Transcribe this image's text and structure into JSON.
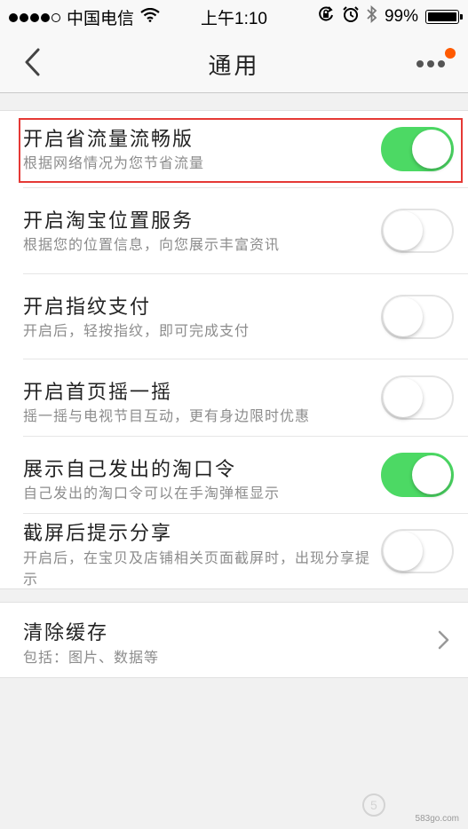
{
  "status_bar": {
    "carrier": "中国电信",
    "time": "上午1:10",
    "battery": "99%",
    "battery_level": 0.99,
    "icons": [
      "signal-dots-icon",
      "wifi-icon",
      "rotation-lock-icon",
      "alarm-icon",
      "bluetooth-icon",
      "battery-icon"
    ]
  },
  "nav": {
    "title": "通用",
    "back_icon": "chevron-left-icon",
    "more_icon": "more-dots-icon",
    "notify_color": "#ff5a00"
  },
  "settings": [
    {
      "title": "开启省流量流畅版",
      "desc": "根据网络情况为您节省流量",
      "on": true
    },
    {
      "title": "开启淘宝位置服务",
      "desc": "根据您的位置信息，向您展示丰富资讯",
      "on": false
    },
    {
      "title": "开启指纹支付",
      "desc": "开启后，轻按指纹，即可完成支付",
      "on": false
    },
    {
      "title": "开启首页摇一摇",
      "desc": "摇一摇与电视节目互动，更有身边限时优惠",
      "on": false
    },
    {
      "title": "展示自己发出的淘口令",
      "desc": "自己发出的淘口令可以在手淘弹框显示",
      "on": true
    },
    {
      "title": "截屏后提示分享",
      "desc": "开启后，在宝贝及店铺相关页面截屏时，出现分享提示",
      "on": false
    }
  ],
  "cache": {
    "title": "清除缓存",
    "desc": "包括：图片、数据等"
  },
  "colors": {
    "toggle_on": "#4cd964",
    "highlight": "#e53935"
  },
  "watermark": "583go.com"
}
